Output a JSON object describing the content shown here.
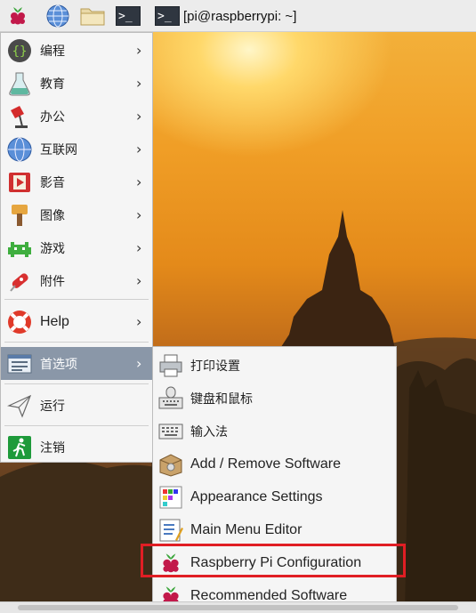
{
  "taskbar": {
    "icons": [
      "raspberry-menu-icon",
      "web-browser-icon",
      "file-manager-icon",
      "terminal-icon"
    ],
    "terminal_prompt": ">_",
    "window_label": "[pi@raspberrypi: ~]"
  },
  "menu": {
    "items": [
      {
        "label": "编程",
        "icon": "programming-icon",
        "submenu": true
      },
      {
        "label": "教育",
        "icon": "education-icon",
        "submenu": true
      },
      {
        "label": "办公",
        "icon": "office-icon",
        "submenu": true
      },
      {
        "label": "互联网",
        "icon": "internet-icon",
        "submenu": true
      },
      {
        "label": "影音",
        "icon": "sound-video-icon",
        "submenu": true
      },
      {
        "label": "图像",
        "icon": "graphics-icon",
        "submenu": true
      },
      {
        "label": "游戏",
        "icon": "games-icon",
        "submenu": true
      },
      {
        "label": "附件",
        "icon": "accessories-icon",
        "submenu": true
      },
      {
        "label": "Help",
        "icon": "help-icon",
        "submenu": true
      },
      {
        "label": "首选项",
        "icon": "preferences-icon",
        "submenu": true,
        "selected": true
      },
      {
        "label": "运行",
        "icon": "run-icon",
        "submenu": false
      },
      {
        "label": "注销",
        "icon": "logout-icon",
        "submenu": false
      }
    ],
    "arrow": "›"
  },
  "submenu": {
    "items": [
      {
        "label": "打印设置",
        "icon": "printer-icon"
      },
      {
        "label": "键盘和鼠标",
        "icon": "keyboard-mouse-icon"
      },
      {
        "label": "输入法",
        "icon": "input-method-icon"
      },
      {
        "label": "Add / Remove Software",
        "icon": "add-remove-software-icon"
      },
      {
        "label": "Appearance Settings",
        "icon": "appearance-icon"
      },
      {
        "label": "Main Menu Editor",
        "icon": "menu-editor-icon"
      },
      {
        "label": "Raspberry Pi Configuration",
        "icon": "raspberry-pi-icon",
        "highlighted": true
      },
      {
        "label": "Recommended Software",
        "icon": "raspberry-pi-icon"
      }
    ]
  },
  "colors": {
    "selected_bg": "#8a97a8",
    "highlight_border": "#e01e24",
    "menu_bg": "#f5f5f5"
  }
}
